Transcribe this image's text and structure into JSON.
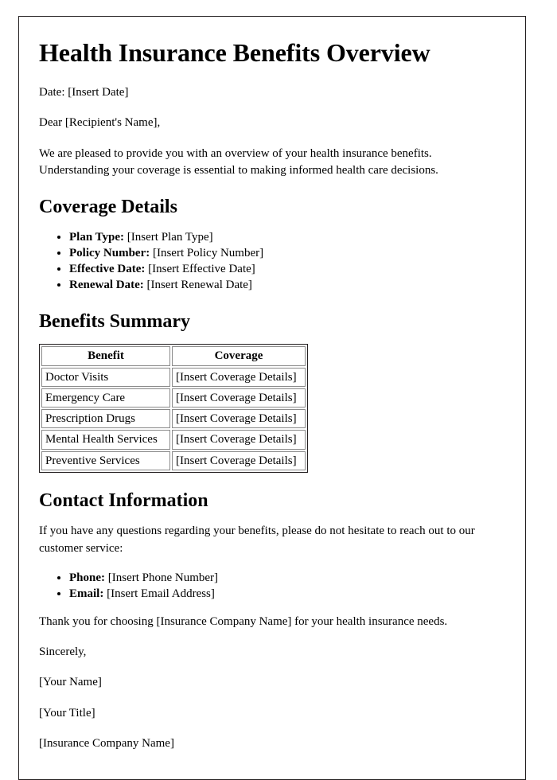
{
  "document": {
    "title": "Health Insurance Benefits Overview",
    "date_line": "Date: [Insert Date]",
    "salutation": "Dear [Recipient's Name],",
    "intro_paragraph": "We are pleased to provide you with an overview of your health insurance benefits. Understanding your coverage is essential to making informed health care decisions."
  },
  "coverage_details": {
    "heading": "Coverage Details",
    "items": [
      {
        "label": "Plan Type:",
        "value": "[Insert Plan Type]"
      },
      {
        "label": "Policy Number:",
        "value": "[Insert Policy Number]"
      },
      {
        "label": "Effective Date:",
        "value": "[Insert Effective Date]"
      },
      {
        "label": "Renewal Date:",
        "value": "[Insert Renewal Date]"
      }
    ]
  },
  "benefits_summary": {
    "heading": "Benefits Summary",
    "columns": [
      "Benefit",
      "Coverage"
    ],
    "rows": [
      {
        "benefit": "Doctor Visits",
        "coverage": "[Insert Coverage Details]"
      },
      {
        "benefit": "Emergency Care",
        "coverage": "[Insert Coverage Details]"
      },
      {
        "benefit": "Prescription Drugs",
        "coverage": "[Insert Coverage Details]"
      },
      {
        "benefit": "Mental Health Services",
        "coverage": "[Insert Coverage Details]"
      },
      {
        "benefit": "Preventive Services",
        "coverage": "[Insert Coverage Details]"
      }
    ]
  },
  "contact_information": {
    "heading": "Contact Information",
    "intro": "If you have any questions regarding your benefits, please do not hesitate to reach out to our customer service:",
    "items": [
      {
        "label": "Phone:",
        "value": "[Insert Phone Number]"
      },
      {
        "label": "Email:",
        "value": "[Insert Email Address]"
      }
    ]
  },
  "closing": {
    "thank_you": "Thank you for choosing [Insurance Company Name] for your health insurance needs.",
    "sign_off": "Sincerely,",
    "name": "[Your Name]",
    "title": "[Your Title]",
    "company": "[Insurance Company Name]"
  }
}
